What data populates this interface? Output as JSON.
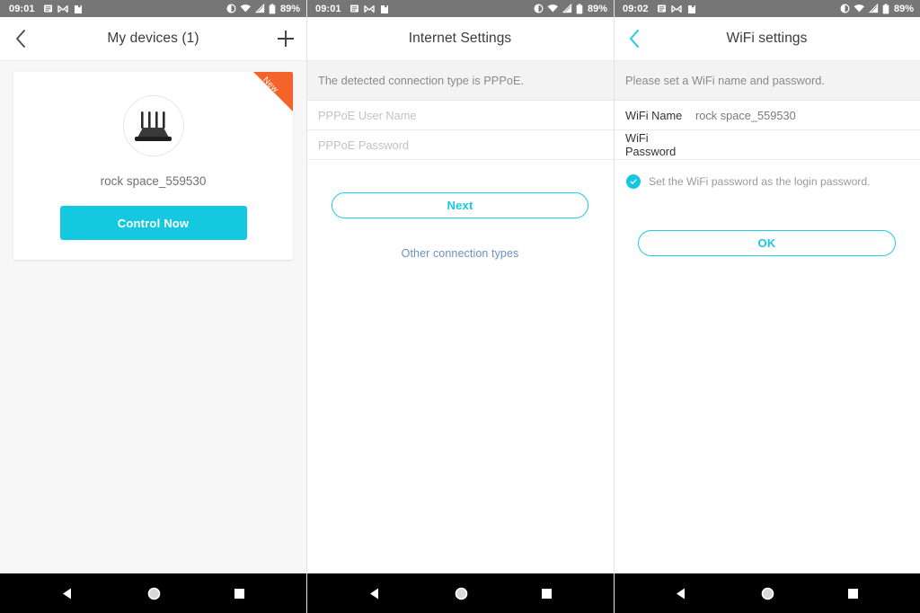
{
  "theme": {
    "accent": "#14c8e0",
    "ribbon": "#f4642a",
    "link": "#6d8fc4",
    "statusbar_bg": "#767676",
    "navbar_bg": "#000000",
    "page_bg": "#f7f7f7"
  },
  "screens": [
    {
      "status": {
        "time": "09:01",
        "battery": "89%",
        "left_icons": [
          "note-icon",
          "gmail-icon",
          "puzzle-icon"
        ],
        "right_icons": [
          "dnd-icon",
          "wifi-off-icon",
          "signal-icon",
          "battery-icon"
        ]
      },
      "appbar": {
        "back_icon": "chevron-left-icon",
        "title": "My devices (1)",
        "action_icon": "plus-icon"
      },
      "card": {
        "ribbon_label": "New",
        "device_icon": "router-icon",
        "device_name": "rock space_559530",
        "button_label": "Control Now"
      },
      "navbar": {
        "back": "back-triangle-icon",
        "home": "home-circle-icon",
        "recents": "recents-square-icon"
      }
    },
    {
      "status": {
        "time": "09:01",
        "battery": "89%",
        "left_icons": [
          "note-icon",
          "gmail-icon",
          "puzzle-icon"
        ],
        "right_icons": [
          "dnd-icon",
          "wifi-off-icon",
          "signal-icon",
          "battery-icon"
        ]
      },
      "appbar": {
        "title": "Internet Settings"
      },
      "notice": "The detected connection type is PPPoE.",
      "fields": [
        {
          "placeholder": "PPPoE User Name",
          "value": ""
        },
        {
          "placeholder": "PPPoE Password",
          "value": ""
        }
      ],
      "primary_button": "Next",
      "link": "Other connection types",
      "navbar": {
        "back": "back-triangle-icon",
        "home": "home-circle-icon",
        "recents": "recents-square-icon"
      }
    },
    {
      "status": {
        "time": "09:02",
        "battery": "89%",
        "left_icons": [
          "note-icon",
          "gmail-icon",
          "puzzle-icon"
        ],
        "right_icons": [
          "dnd-icon",
          "wifi-off-icon",
          "signal-icon",
          "battery-icon"
        ]
      },
      "appbar": {
        "back_icon": "chevron-left-icon",
        "title": "WiFi settings"
      },
      "notice": "Please set a WiFi name and password.",
      "fields": [
        {
          "label": "WiFi Name",
          "value": "rock space_559530"
        },
        {
          "label": "WiFi Password",
          "value": ""
        }
      ],
      "checkbox": {
        "checked": true,
        "label": "Set the WiFi password as the login password."
      },
      "primary_button": "OK",
      "navbar": {
        "back": "back-triangle-icon",
        "home": "home-circle-icon",
        "recents": "recents-square-icon"
      }
    }
  ]
}
